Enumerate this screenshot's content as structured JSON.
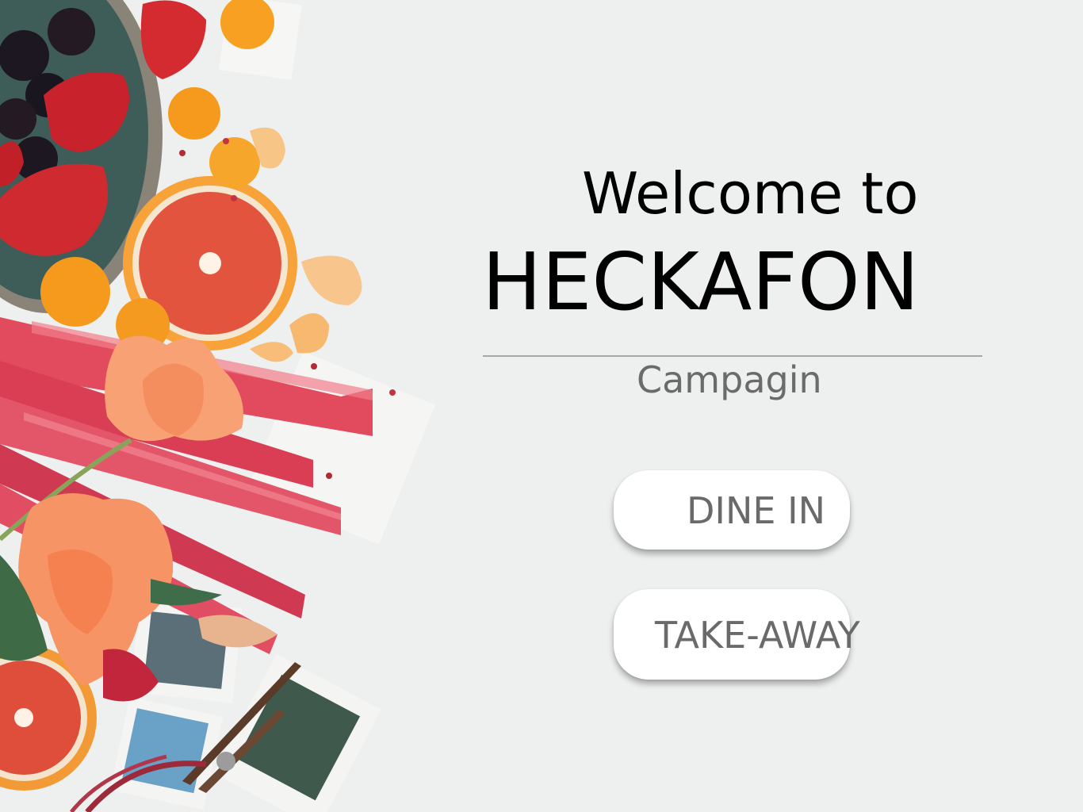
{
  "hero": {
    "welcome_line": "Welcome to",
    "brand_name": "HECKAFON",
    "subtitle": "Campagin"
  },
  "actions": {
    "dine_in_label": "DINE IN",
    "take_away_label": "TAKE-AWAY"
  },
  "colors": {
    "background": "#eef0ef",
    "button_bg": "#ffffff",
    "button_text": "#6a6a6a",
    "subtitle_text": "#6b6b6b",
    "divider": "#a3a7a6"
  }
}
